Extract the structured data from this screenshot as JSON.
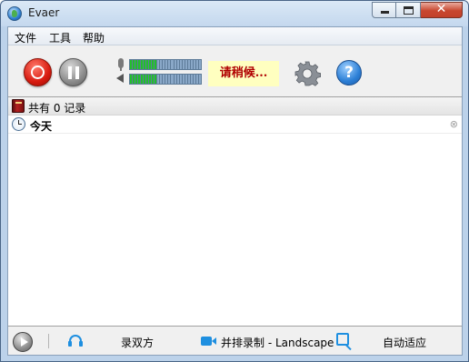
{
  "window": {
    "title": "Evaer"
  },
  "menu": {
    "items": [
      "文件",
      "工具",
      "帮助"
    ]
  },
  "toolbar": {
    "status_text": "请稍候...",
    "record_icon": "record-icon",
    "pause_icon": "pause-icon",
    "settings_icon": "gear-icon",
    "help_icon": "help-icon",
    "help_glyph": "?",
    "mic_level": 0.38,
    "speaker_level": 0.38,
    "colors": {
      "status_bg": "#ffffc0",
      "status_text": "#b00000",
      "meter_on": "#22c02a"
    }
  },
  "list": {
    "header": "共有 0 记录",
    "group_label": "今天"
  },
  "statusbar": {
    "audio_mode": "录双方",
    "video_mode": "并排录制 - Landscape",
    "fit_mode": "自动适应"
  }
}
